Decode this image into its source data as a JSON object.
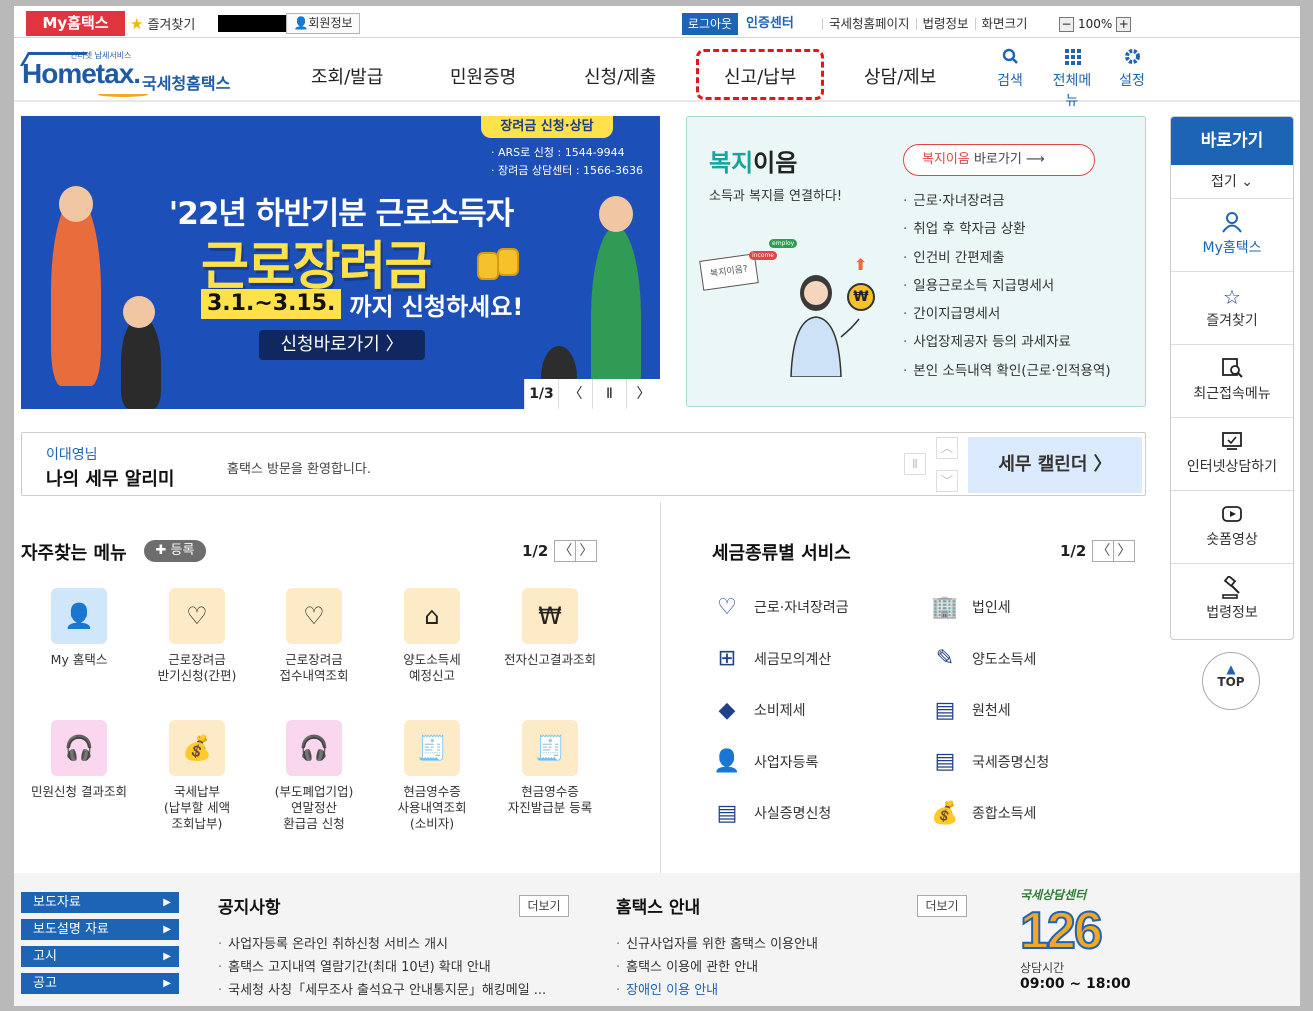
{
  "topbar": {
    "my_tab": "My홈택스",
    "favorites": "즐겨찾기",
    "member_info": "회원정보",
    "logout": "로그아웃",
    "cert_center": "인증센터",
    "links": [
      "국세청홈페이지",
      "법령정보",
      "화면크기"
    ],
    "zoom_minus": "−",
    "zoom_value": "100%",
    "zoom_plus": "+"
  },
  "nav": {
    "logo_tagline": "인터넷 납세서비스",
    "logo_text": "Hometax.",
    "logo_kr": "국세청홈택스",
    "menus": [
      "조회/발급",
      "민원증명",
      "신청/제출",
      "신고/납부",
      "상담/제보"
    ],
    "tools": [
      {
        "label": "검색",
        "icon": "search-icon"
      },
      {
        "label": "전체메뉴",
        "icon": "grid-icon"
      },
      {
        "label": "설정",
        "icon": "gear-icon"
      }
    ]
  },
  "banner": {
    "tag": "장려금 신청·상담",
    "info_lines": [
      "· ARS로 신청 : 1544-9944",
      "· 장려금 상담센터 : 1566-3636"
    ],
    "headline": "'22년 하반기분 근로소득자",
    "big": "근로장려금",
    "date_box": "3.1.~3.15.",
    "date_text": "까지 신청하세요!",
    "apply": "신청바로가기 〉",
    "page": "1/3",
    "prev": "〈",
    "pause": "Ⅱ",
    "next": "〉"
  },
  "welfare": {
    "title_green": "복지",
    "title_rest": "이음",
    "subtitle": "소득과 복지를 연결하다!",
    "go_red": "복지이음",
    "go_rest": " 바로가기 ⟶",
    "items": [
      "근로·자녀장려금",
      "취업 후 학자금 상환",
      "인건비 간편제출",
      "일용근로소득 지급명세서",
      "간이지급명세서",
      "사업장제공자 등의 과세자료",
      "본인 소득내역 확인(근로·인적용역)"
    ],
    "bubble": "복지이음?",
    "tags": [
      "employ",
      "income"
    ]
  },
  "alert": {
    "user": "이대영님",
    "label": "나의 세무 알리미",
    "message": "홈택스 방문을 환영합니다.",
    "up": "︿",
    "down": "﹀",
    "pause": "Ⅱ",
    "calendar": "세무 캘린더 〉"
  },
  "frequent": {
    "title": "자주찾는 메뉴",
    "add": "✚ 등록",
    "page": "1/2",
    "prev": "〈",
    "next": "〉",
    "items": [
      {
        "label": "My 홈택스",
        "icon": "person-icon",
        "color": "#cfe6fb"
      },
      {
        "label": "근로장려금\n반기신청(간편)",
        "icon": "heart-money-icon",
        "color": "#fcebc6"
      },
      {
        "label": "근로장려금\n접수내역조회",
        "icon": "heart-money-icon",
        "color": "#fcebc6"
      },
      {
        "label": "양도소득세\n예정신고",
        "icon": "house-icon",
        "color": "#fcebc6"
      },
      {
        "label": "전자신고결과조회",
        "icon": "won-search-icon",
        "color": "#fcebc6"
      },
      {
        "label": "민원신청 결과조회",
        "icon": "headset-icon",
        "color": "#fbd6ef"
      },
      {
        "label": "국세납부\n(납부할 세액\n조회납부)",
        "icon": "money-bag-icon",
        "color": "#fcebc6"
      },
      {
        "label": "(부도폐업기업)\n연말정산\n환급금 신청",
        "icon": "headset-icon",
        "color": "#fbd6ef"
      },
      {
        "label": "현금영수증\n사용내역조회\n(소비자)",
        "icon": "receipt-search-icon",
        "color": "#fcebc6"
      },
      {
        "label": "현금영수증\n자진발급분 등록",
        "icon": "receipt-search-icon",
        "color": "#fcebc6"
      }
    ]
  },
  "taxservice": {
    "title": "세금종류별 서비스",
    "page": "1/2",
    "prev": "〈",
    "next": "〉",
    "items": [
      {
        "label": "근로·자녀장려금",
        "icon": "heart-icon"
      },
      {
        "label": "법인세",
        "icon": "building-icon"
      },
      {
        "label": "세금모의계산",
        "icon": "calculator-icon"
      },
      {
        "label": "양도소득세",
        "icon": "document-pen-icon"
      },
      {
        "label": "소비제세",
        "icon": "diamond-icon"
      },
      {
        "label": "원천세",
        "icon": "salary-doc-icon"
      },
      {
        "label": "사업자등록",
        "icon": "person-icon"
      },
      {
        "label": "국세증명신청",
        "icon": "document-icon"
      },
      {
        "label": "사실증명신청",
        "icon": "document-icon"
      },
      {
        "label": "종합소득세",
        "icon": "money-bag-icon"
      }
    ]
  },
  "quick": {
    "title": "바로가기",
    "fold": "접기 ⌄",
    "items": [
      {
        "label": "My홈택스",
        "icon": "person-icon"
      },
      {
        "label": "즐겨찾기",
        "icon": "star-icon"
      },
      {
        "label": "최근접속메뉴",
        "icon": "recent-search-icon"
      },
      {
        "label": "인터넷상담하기",
        "icon": "monitor-icon"
      },
      {
        "label": "숏폼영상",
        "icon": "play-icon"
      },
      {
        "label": "법령정보",
        "icon": "gavel-icon"
      }
    ],
    "top": "TOP"
  },
  "footer": {
    "buttons": [
      "보도자료",
      "보도설명 자료",
      "고시",
      "공고"
    ],
    "notice_title": "공지사항",
    "notice_more": "더보기",
    "notices": [
      "사업자등록 온라인 취하신청 서비스 개시",
      "홈택스 고지내역 열람기간(최대 10년) 확대 안내",
      "국세청 사칭「세무조사 출석요구 안내통지문」해킹메일 ..."
    ],
    "guide_title": "홈택스 안내",
    "guide_more": "더보기",
    "guides": [
      "신규사업자를 위한 홈택스 이용안내",
      "홈택스 이용에 관한 안내",
      "장애인 이용 안내"
    ],
    "center_label": "국세상담센터",
    "center_number": "126",
    "center_hours_label": "상담시간",
    "center_hours": "09:00 ~ 18:00"
  }
}
